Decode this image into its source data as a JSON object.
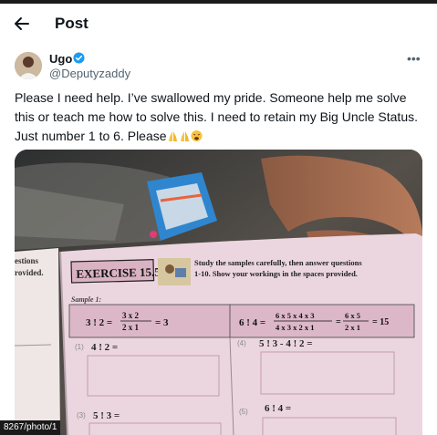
{
  "header": {
    "title": "Post"
  },
  "author": {
    "name": "Ugo",
    "handle": "@Deputyzaddy"
  },
  "tweet": {
    "text": "Please I need help. I’ve swallowed my pride. Someone help me solve this or teach me how to solve this. I need to retain my Big Uncle Status.  Just number 1 to 6. Please"
  },
  "photo": {
    "left_page": {
      "line1": "estions",
      "line2": "rovided."
    },
    "exercise_title": "EXERCISE 15.5",
    "instructions": "Study the samples carefully, then answer questions 1-10. Show your workings in the spaces provided.",
    "sample_label": "Sample 1:",
    "sample_a": {
      "lhs": "3 ! 2 =",
      "num": "3 x 2",
      "den": "2 x 1",
      "result": "= 3"
    },
    "sample_b": {
      "lhs": "6 ! 4 =",
      "num": "6 x 5 x 4 x 3",
      "den": "4 x 3 x 2 x 1",
      "num2": "6 x 5",
      "den2": "2 x 1",
      "result": "= 15"
    },
    "questions": [
      {
        "num": "(1)",
        "expr": "4 ! 2 ="
      },
      {
        "num": "(4)",
        "expr": "5 ! 3 - 4 ! 2 ="
      },
      {
        "num": "(3)",
        "expr": "5 ! 3 ="
      },
      {
        "num": "(5)",
        "expr": "6 ! 4 ="
      }
    ]
  },
  "url_fragment": "8267/photo/1",
  "icons": [
    "back-arrow-icon",
    "verified-badge-icon",
    "more-options-icon",
    "folded-hands-emoji",
    "weary-face-emoji"
  ],
  "colors": {
    "verified": "#1d9bf0",
    "text": "#0f1419",
    "muted": "#536471",
    "page_pink": "#e9c6d4"
  }
}
